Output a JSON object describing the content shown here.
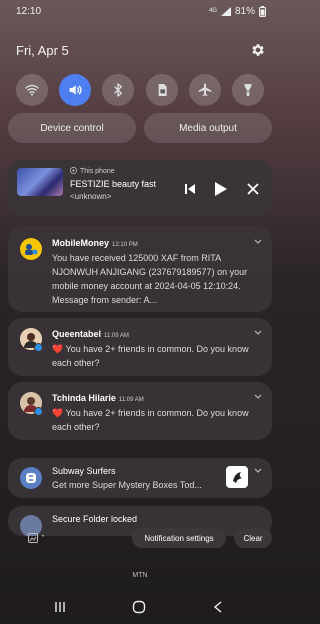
{
  "status": {
    "time": "12:10",
    "network": "4G",
    "battery": "81%"
  },
  "header": {
    "date": "Fri, Apr 5"
  },
  "quick_settings": [
    {
      "name": "wifi-icon",
      "active": false
    },
    {
      "name": "sound-icon",
      "active": true
    },
    {
      "name": "bluetooth-icon",
      "active": false
    },
    {
      "name": "sim-icon",
      "active": false
    },
    {
      "name": "airplane-icon",
      "active": false
    },
    {
      "name": "flashlight-icon",
      "active": false
    }
  ],
  "pills": {
    "device_control": "Device control",
    "media_output": "Media output"
  },
  "media": {
    "source": "This phone",
    "title": "FESTIZIE beauty fast",
    "artist": "<unknown>"
  },
  "notifications": {
    "mobilemoney": {
      "app": "MobileMoney",
      "time": "12:10 PM",
      "body": "You have received 125000 XAF from RITA NJONWUH ANJIGANG (237679189577) on your mobile money account at 2024-04-05 12:10:24. Message from sender: A..."
    },
    "queentabel": {
      "app": "Queentabel",
      "time": "11:09 AM",
      "body": "❤️ You have 2+ friends in common. Do you know each other?"
    },
    "tchinda": {
      "app": "Tchinda Hilarie",
      "time": "11:09 AM",
      "body": "❤️ You have 2+ friends in common. Do you know each other?"
    },
    "subway": {
      "app": "Subway Surfers",
      "body": "Get more Super Mystery Boxes Tod..."
    },
    "secure": {
      "app": "Secure Folder locked"
    }
  },
  "actions": {
    "notification_settings": "Notification settings",
    "clear": "Clear"
  },
  "carrier": "MTN"
}
